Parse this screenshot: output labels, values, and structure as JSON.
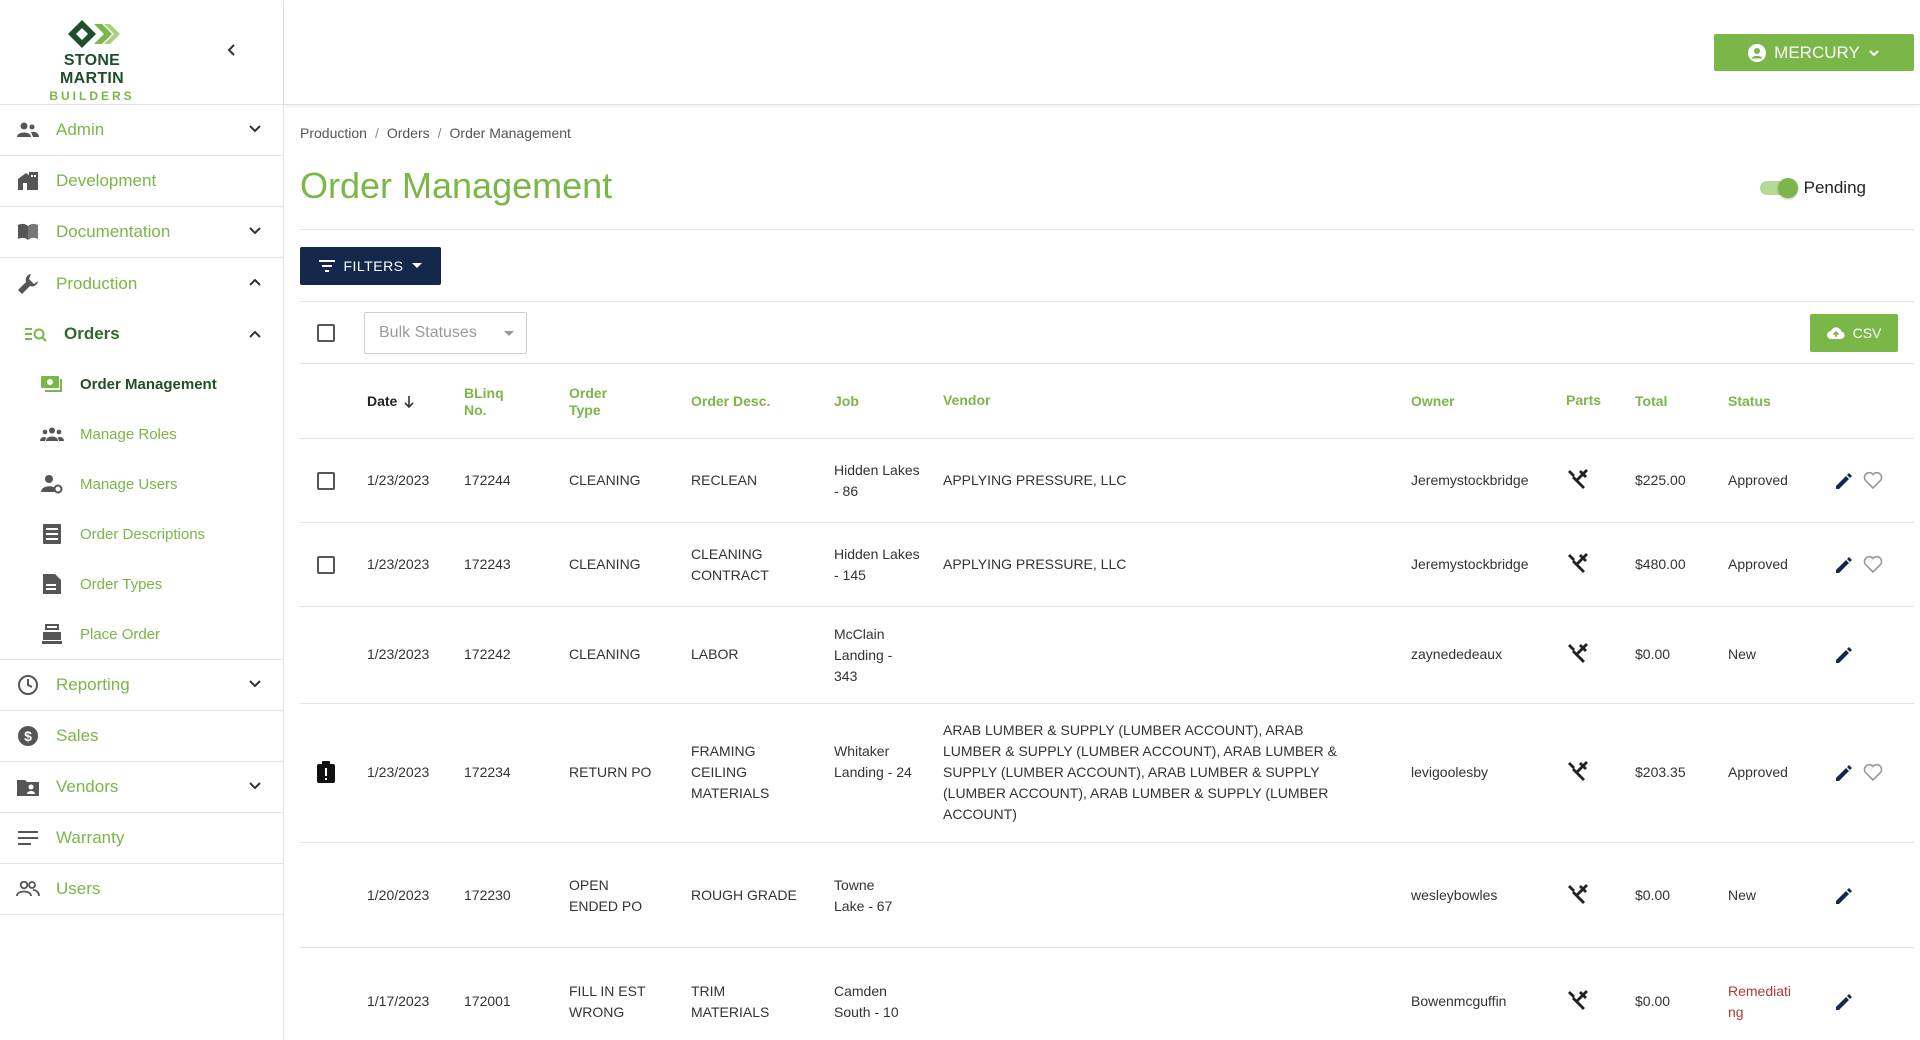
{
  "brand": {
    "line1": "STONE MARTIN",
    "line2": "BUILDERS"
  },
  "user": {
    "name": "MERCURY"
  },
  "sidebar": {
    "items": [
      {
        "label": "Admin"
      },
      {
        "label": "Development"
      },
      {
        "label": "Documentation"
      },
      {
        "label": "Production"
      },
      {
        "label": "Reporting"
      },
      {
        "label": "Sales"
      },
      {
        "label": "Vendors"
      },
      {
        "label": "Warranty"
      },
      {
        "label": "Users"
      }
    ],
    "orders": {
      "label": "Orders",
      "children": [
        {
          "label": "Order Management"
        },
        {
          "label": "Manage Roles"
        },
        {
          "label": "Manage Users"
        },
        {
          "label": "Order Descriptions"
        },
        {
          "label": "Order Types"
        },
        {
          "label": "Place Order"
        }
      ]
    }
  },
  "breadcrumb": {
    "b1": "Production",
    "b2": "Orders",
    "b3": "Order Management",
    "sep": "/"
  },
  "page": {
    "title": "Order Management",
    "toggle_label": "Pending",
    "toggle_on": true
  },
  "toolbar": {
    "filters_label": "FILTERS",
    "bulk_placeholder": "Bulk Statuses",
    "csv_label": "CSV"
  },
  "table": {
    "headers": {
      "date": "Date",
      "blinq1": "BLinq",
      "blinq2": "No.",
      "type1": "Order",
      "type2": "Type",
      "desc": "Order Desc.",
      "job": "Job",
      "vendor": "Vendor",
      "owner": "Owner",
      "parts": "Parts",
      "total": "Total",
      "status": "Status"
    },
    "rows": [
      {
        "date": "1/23/2023",
        "no": "172244",
        "type": "CLEANING",
        "desc": "RECLEAN",
        "job": "Hidden Lakes - 86",
        "vendor": "APPLYING PRESSURE, LLC",
        "owner": "Jeremystockbridge",
        "total": "$225.00",
        "status": "Approved"
      },
      {
        "date": "1/23/2023",
        "no": "172243",
        "type": "CLEANING",
        "desc": "CLEANING CONTRACT",
        "job": "Hidden Lakes - 145",
        "vendor": "APPLYING PRESSURE, LLC",
        "owner": "Jeremystockbridge",
        "total": "$480.00",
        "status": "Approved"
      },
      {
        "date": "1/23/2023",
        "no": "172242",
        "type": "CLEANING",
        "desc": "LABOR",
        "job": "McClain Landing - 343",
        "vendor": "",
        "owner": "zaynededeaux",
        "total": "$0.00",
        "status": "New"
      },
      {
        "date": "1/23/2023",
        "no": "172234",
        "type": "RETURN PO",
        "desc": "FRAMING CEILING MATERIALS",
        "job": "Whitaker Landing - 24",
        "vendor": "ARAB LUMBER & SUPPLY (LUMBER ACCOUNT), ARAB LUMBER & SUPPLY (LUMBER ACCOUNT), ARAB LUMBER & SUPPLY (LUMBER ACCOUNT), ARAB LUMBER & SUPPLY (LUMBER ACCOUNT), ARAB LUMBER & SUPPLY (LUMBER ACCOUNT)",
        "owner": "levigoolesby",
        "total": "$203.35",
        "status": "Approved"
      },
      {
        "date": "1/20/2023",
        "no": "172230",
        "type": "OPEN ENDED PO",
        "desc": "ROUGH GRADE",
        "job": "Towne Lake - 67",
        "vendor": "",
        "owner": "wesleybowles",
        "total": "$0.00",
        "status": "New"
      },
      {
        "date": "1/17/2023",
        "no": "172001",
        "type": "FILL IN EST WRONG",
        "desc": "TRIM MATERIALS",
        "job": "Camden South - 10",
        "vendor": "",
        "owner": "Bowenmcguffin",
        "total": "$0.00",
        "status": "Remediating"
      }
    ]
  },
  "colors": {
    "accent": "#7ab648",
    "navy": "#14284b",
    "dark_green": "#1f4f2a",
    "status_red": "#b03a2e"
  },
  "icons": [
    "chevron-left-icon",
    "account-circle-icon",
    "admin-people-icon",
    "building-icon",
    "book-icon",
    "wrench-icon",
    "search-list-icon",
    "money-icon",
    "group-icon",
    "user-gear-icon",
    "list-doc-icon",
    "file-icon",
    "cash-register-icon",
    "clock-icon",
    "dollar-icon",
    "folder-account-icon",
    "lines-icon",
    "users-icon",
    "filter-icon",
    "cloud-upload-icon",
    "sort-arrow-down-icon",
    "tools-icon",
    "edit-icon",
    "heart-outline-icon",
    "clipboard-alert-icon"
  ]
}
